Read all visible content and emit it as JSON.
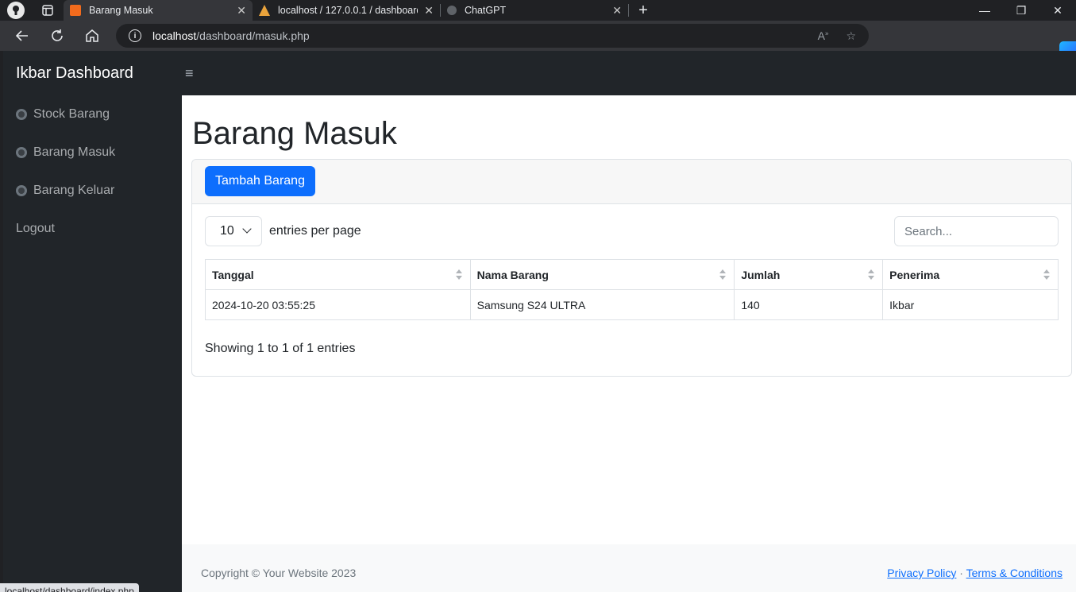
{
  "browser": {
    "tabs": [
      {
        "label": "Barang Masuk",
        "favicon_color": "#f26b1d",
        "active": true
      },
      {
        "label": "localhost / 127.0.0.1 / dashboard ...",
        "favicon_color": "#e8a23b",
        "active": false
      },
      {
        "label": "ChatGPT",
        "favicon_color": "#9aa0a6",
        "active": false
      }
    ],
    "url_host": "localhost",
    "url_path": "/dashboard/masuk.php",
    "status_url": "localhost/dashboard/index.php"
  },
  "topnav": {
    "brand": "Ikbar Dashboard",
    "toggle_icon": "hamburger-icon"
  },
  "sidebar": {
    "items": [
      {
        "label": "Stock Barang",
        "icon": "tachometer-icon"
      },
      {
        "label": "Barang Masuk",
        "icon": "tachometer-icon"
      },
      {
        "label": "Barang Keluar",
        "icon": "tachometer-icon"
      },
      {
        "label": "Logout"
      }
    ]
  },
  "main": {
    "title": "Barang Masuk",
    "add_button": "Tambah Barang",
    "entries_value": "10",
    "entries_label": "entries per page",
    "search_placeholder": "Search...",
    "table": {
      "columns": [
        "Tanggal",
        "Nama Barang",
        "Jumlah",
        "Penerima"
      ],
      "rows": [
        [
          "2024-10-20 03:55:25",
          "Samsung S24 ULTRA",
          "140",
          "Ikbar"
        ]
      ]
    },
    "info": "Showing 1 to 1 of 1 entries"
  },
  "footer": {
    "copyright": "Copyright © Your Website 2023",
    "privacy": "Privacy Policy",
    "separator": "·",
    "terms": "Terms & Conditions"
  },
  "colors": {
    "primary": "#0d6efd",
    "sidebar_bg": "#212529"
  }
}
